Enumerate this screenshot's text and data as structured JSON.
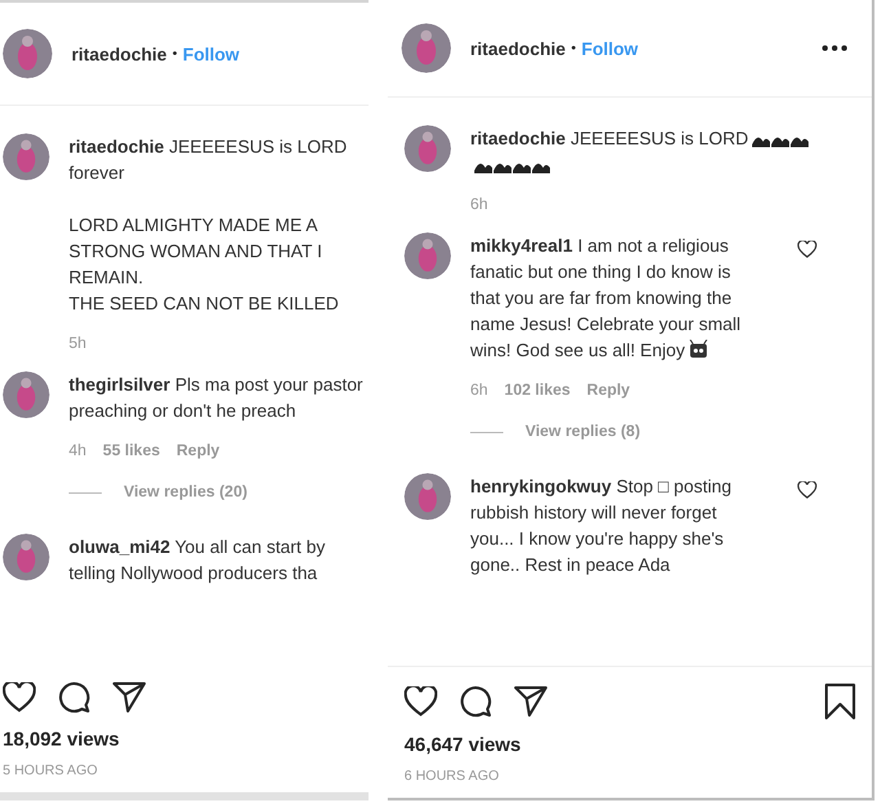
{
  "posts": [
    {
      "author": "ritaedochie",
      "separator": "•",
      "follow": "Follow",
      "caption": {
        "author": "ritaedochie",
        "text": "JEEEEESUS is LORD\nforever\n\nLORD ALMIGHTY MADE ME A\nSTRONG WOMAN AND THAT I\nREMAIN.\nTHE SEED CAN NOT BE KILLED",
        "time": "5h"
      },
      "comments": [
        {
          "author": "thegirlsilver",
          "text": "Pls ma post your pastor preaching or don't he preach",
          "time": "4h",
          "likes": "55 likes",
          "reply": "Reply",
          "view_replies": "View replies (20)"
        },
        {
          "author": "oluwa_mi42",
          "text": "You all can start by telling Nollywood producers tha"
        }
      ],
      "views": "18,092 views",
      "posted": "5 HOURS AGO"
    },
    {
      "author": "ritaedochie",
      "separator": "•",
      "follow": "Follow",
      "more_menu": true,
      "bookmark": true,
      "caption": {
        "author": "ritaedochie",
        "text": "JEEEEESUS is LORD",
        "trailing_emoji": true,
        "time": "6h"
      },
      "comments": [
        {
          "author": "mikky4real1",
          "text": "I am not a religious fanatic but one thing I do know is that you are far from knowing the name Jesus! Celebrate your small wins! God see us all! Enjoy",
          "trailing_emoji": true,
          "like_button": true,
          "time": "6h",
          "likes": "102 likes",
          "reply": "Reply",
          "view_replies": "View replies (8)"
        },
        {
          "author": "henrykingokwuy",
          "text": "Stop □ posting rubbish history will never forget you... I know you're happy she's gone.. Rest in peace Ada",
          "like_button": true
        }
      ],
      "views": "46,647 views",
      "posted": "6 HOURS AGO"
    }
  ]
}
